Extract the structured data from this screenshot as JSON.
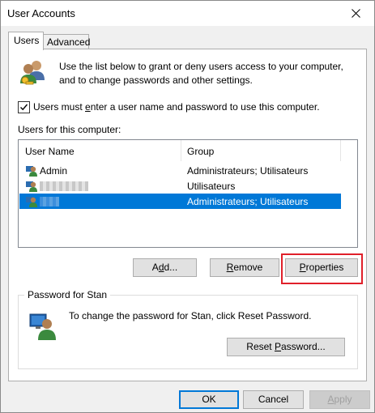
{
  "window": {
    "title": "User Accounts"
  },
  "tabs": [
    {
      "label": "Users",
      "active": true
    },
    {
      "label": "Advanced",
      "active": false
    }
  ],
  "intro": {
    "line1": "Use the list below to grant or deny users access to your computer,",
    "line2": "and to change passwords and other settings."
  },
  "require_login": {
    "label_pre": "Users must ",
    "label_u": "e",
    "label_post": "nter a user name and password to use this computer.",
    "checked": true
  },
  "users_list": {
    "label": "Users for this computer:",
    "columns": [
      "User Name",
      "Group"
    ],
    "rows": [
      {
        "name": "Admin",
        "group": "Administrateurs; Utilisateurs",
        "selected": false
      },
      {
        "name": "",
        "group": "Utilisateurs",
        "selected": false
      },
      {
        "name": "",
        "group": "Administrateurs; Utilisateurs",
        "selected": true
      }
    ]
  },
  "buttons": {
    "add": {
      "pre": "A",
      "u": "d",
      "post": "d..."
    },
    "remove": {
      "pre": "",
      "u": "R",
      "post": "emove"
    },
    "properties": {
      "pre": "",
      "u": "P",
      "post": "roperties"
    }
  },
  "password": {
    "group_label": "Password for Stan",
    "text": "To change the password for Stan, click Reset Password.",
    "reset": {
      "pre": "Reset ",
      "u": "P",
      "post": "assword..."
    }
  },
  "footer": {
    "ok": "OK",
    "cancel": "Cancel",
    "apply": {
      "pre": "",
      "u": "A",
      "post": "pply"
    }
  },
  "colors": {
    "selection": "#0078d7",
    "highlight_box": "#e0202a"
  }
}
